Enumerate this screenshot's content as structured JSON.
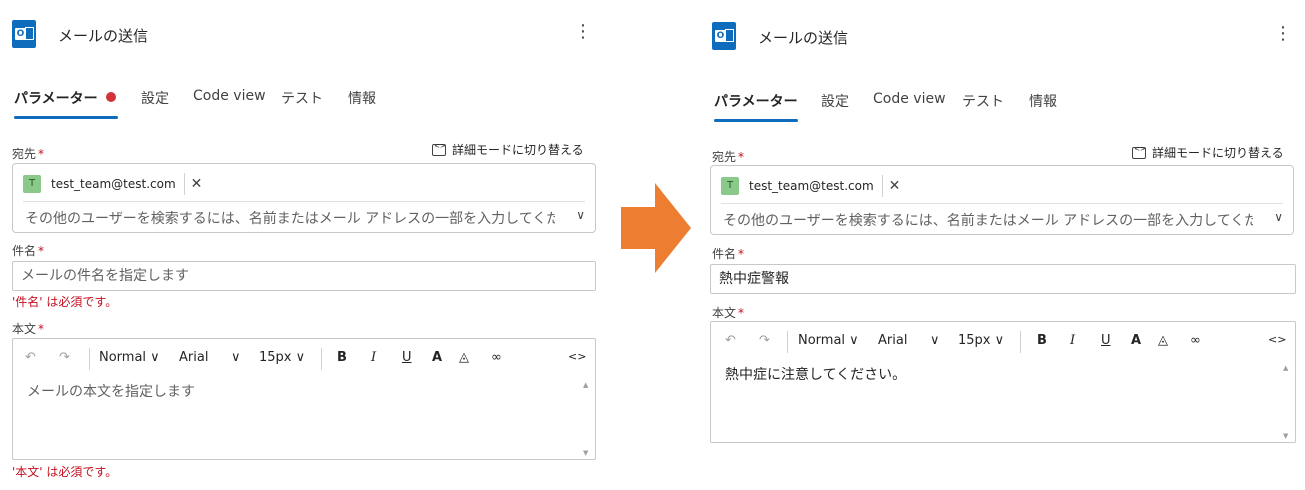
{
  "left": {
    "header": {
      "title": "メールの送信",
      "menu_icon": "more-vertical-icon"
    },
    "tabs": [
      {
        "label": "パラメーター"
      },
      {
        "label": "設定"
      },
      {
        "label": "Code view"
      },
      {
        "label": "テスト"
      },
      {
        "label": "情報"
      }
    ],
    "active_tab_has_error": true,
    "advanced_mode_label": "詳細モードに切り替える",
    "to": {
      "label": "宛先",
      "required_mark": "*",
      "chip_initial": "T",
      "chip_email": "test_team@test.com",
      "chip_remove": "✕",
      "placeholder": "その他のユーザーを検索するには、名前またはメール アドレスの一部を入力してくだ",
      "chevron": "∨"
    },
    "subject": {
      "label": "件名",
      "required_mark": "*",
      "placeholder": "メールの件名を指定します",
      "value": "",
      "error": "'件名' は必須です。"
    },
    "body": {
      "label": "本文",
      "required_mark": "*",
      "toolbar": {
        "undo": "↶",
        "redo": "↷",
        "style": "Normal ∨",
        "font": "Arial",
        "font_chevron": "∨",
        "size": "15px ∨",
        "bold": "B",
        "italic": "I",
        "underline": "U",
        "font_color": "A",
        "highlight": "◬",
        "link": "∞",
        "code": "<>"
      },
      "placeholder": "メールの本文を指定します",
      "value": "",
      "error": "'本文' は必須です。"
    }
  },
  "right": {
    "header": {
      "title": "メールの送信",
      "menu_icon": "more-vertical-icon"
    },
    "tabs": [
      {
        "label": "パラメーター"
      },
      {
        "label": "設定"
      },
      {
        "label": "Code view"
      },
      {
        "label": "テスト"
      },
      {
        "label": "情報"
      }
    ],
    "active_tab_has_error": false,
    "advanced_mode_label": "詳細モードに切り替える",
    "to": {
      "label": "宛先",
      "required_mark": "*",
      "chip_initial": "T",
      "chip_email": "test_team@test.com",
      "chip_remove": "✕",
      "placeholder": "その他のユーザーを検索するには、名前またはメール アドレスの一部を入力してくだ",
      "chevron": "∨"
    },
    "subject": {
      "label": "件名",
      "required_mark": "*",
      "value": "熱中症警報"
    },
    "body": {
      "label": "本文",
      "required_mark": "*",
      "toolbar": {
        "undo": "↶",
        "redo": "↷",
        "style": "Normal ∨",
        "font": "Arial",
        "font_chevron": "∨",
        "size": "15px ∨",
        "bold": "B",
        "italic": "I",
        "underline": "U",
        "font_color": "A",
        "highlight": "◬",
        "link": "∞",
        "code": "<>"
      },
      "value": "熱中症に注意してください。"
    }
  },
  "arrow": {
    "color": "#ed7d31",
    "icon": "right-arrow-icon"
  }
}
